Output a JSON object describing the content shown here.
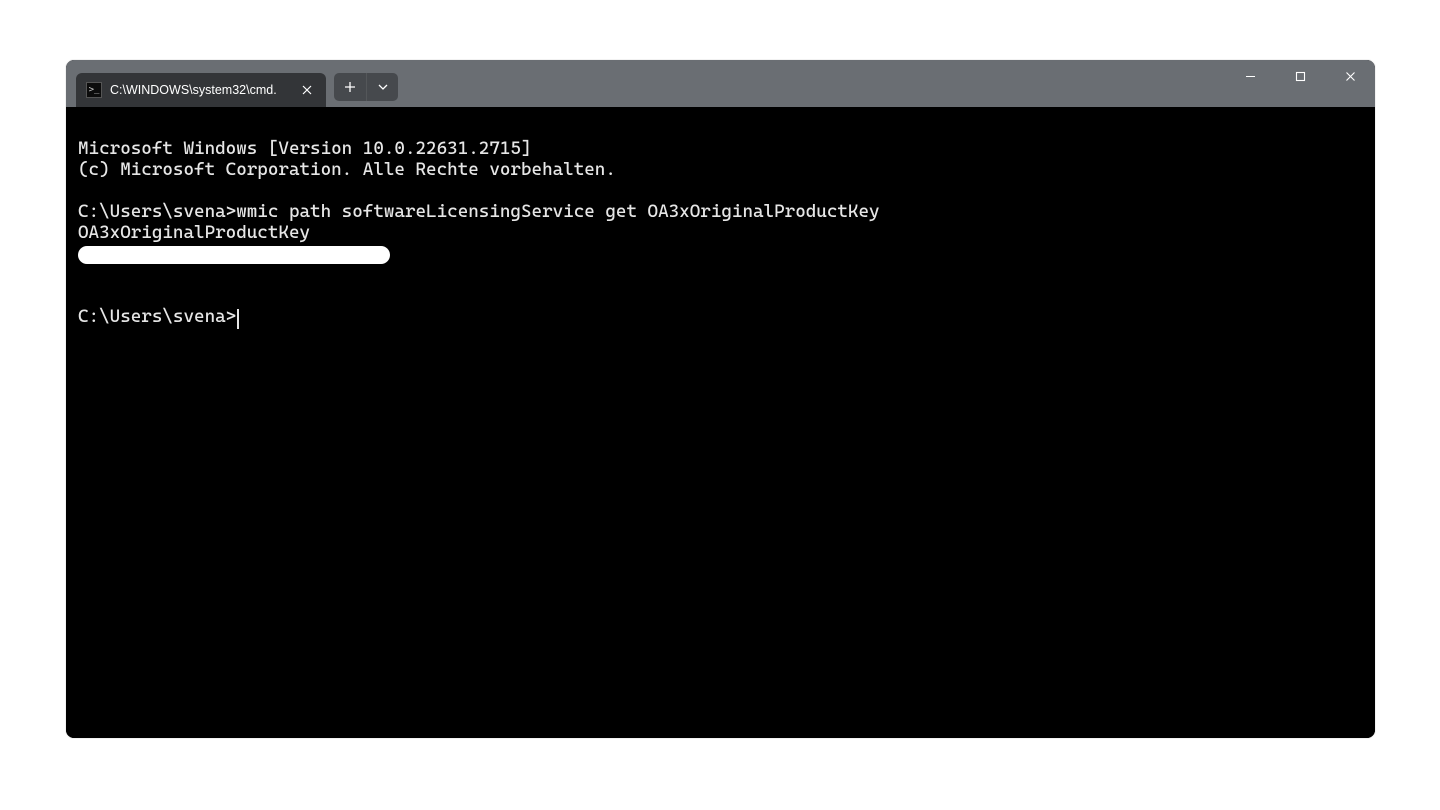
{
  "titlebar": {
    "tab_title": "C:\\WINDOWS\\system32\\cmd."
  },
  "terminal": {
    "line1": "Microsoft Windows [Version 10.0.22631.2715]",
    "line2": "(c) Microsoft Corporation. Alle Rechte vorbehalten.",
    "blank1": "",
    "prompt1_prefix": "C:\\Users\\svena>",
    "command1": "wmic path softwareLicensingService get OA3xOriginalProductKey",
    "output_header": "OA3xOriginalProductKey",
    "blank2": "",
    "blank3": "",
    "prompt2_prefix": "C:\\Users\\svena>"
  }
}
